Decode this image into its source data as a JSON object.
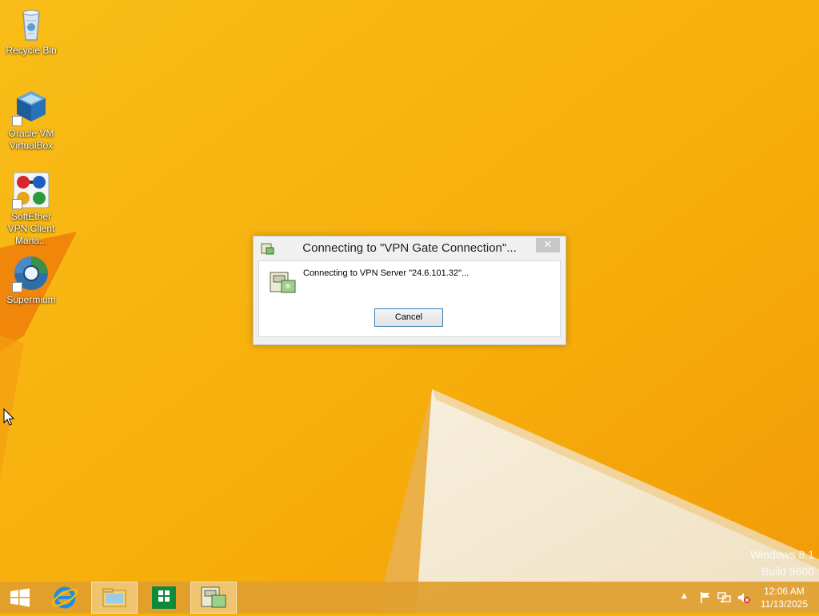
{
  "desktop": {
    "icons": [
      {
        "label": "Recycle Bin",
        "icon": "recycle-bin-icon"
      },
      {
        "label": "Oracle VM VirtualBox",
        "icon": "virtualbox-icon"
      },
      {
        "label": "SoftEther VPN Client Mana...",
        "icon": "softether-vpn-icon"
      },
      {
        "label": "Supermium",
        "icon": "supermium-browser-icon"
      }
    ],
    "watermark": {
      "line1": "Windows 8.1",
      "line2": "Build 9600"
    }
  },
  "dialog": {
    "title": "Connecting to \"VPN Gate Connection\"...",
    "message": "Connecting to VPN Server \"24.6.101.32\"...",
    "cancel_label": "Cancel",
    "close_glyph": "✕"
  },
  "taskbar": {
    "items": [
      {
        "name": "start",
        "icon": "windows-start-icon"
      },
      {
        "name": "internet-explorer",
        "icon": "internet-explorer-icon"
      },
      {
        "name": "file-explorer",
        "icon": "file-explorer-icon"
      },
      {
        "name": "store",
        "icon": "windows-store-icon"
      },
      {
        "name": "softether-vpn",
        "icon": "softether-vpn-icon"
      }
    ],
    "tray": {
      "show_hidden_glyph": "▲",
      "time": "12:06 AM",
      "date": "11/13/2025"
    }
  },
  "colors": {
    "wallpaper_orange": "#f7b500",
    "wallpaper_dark": "#ef7f0a",
    "taskbar": "#df9e2e",
    "button_border": "#3c7fb1"
  }
}
